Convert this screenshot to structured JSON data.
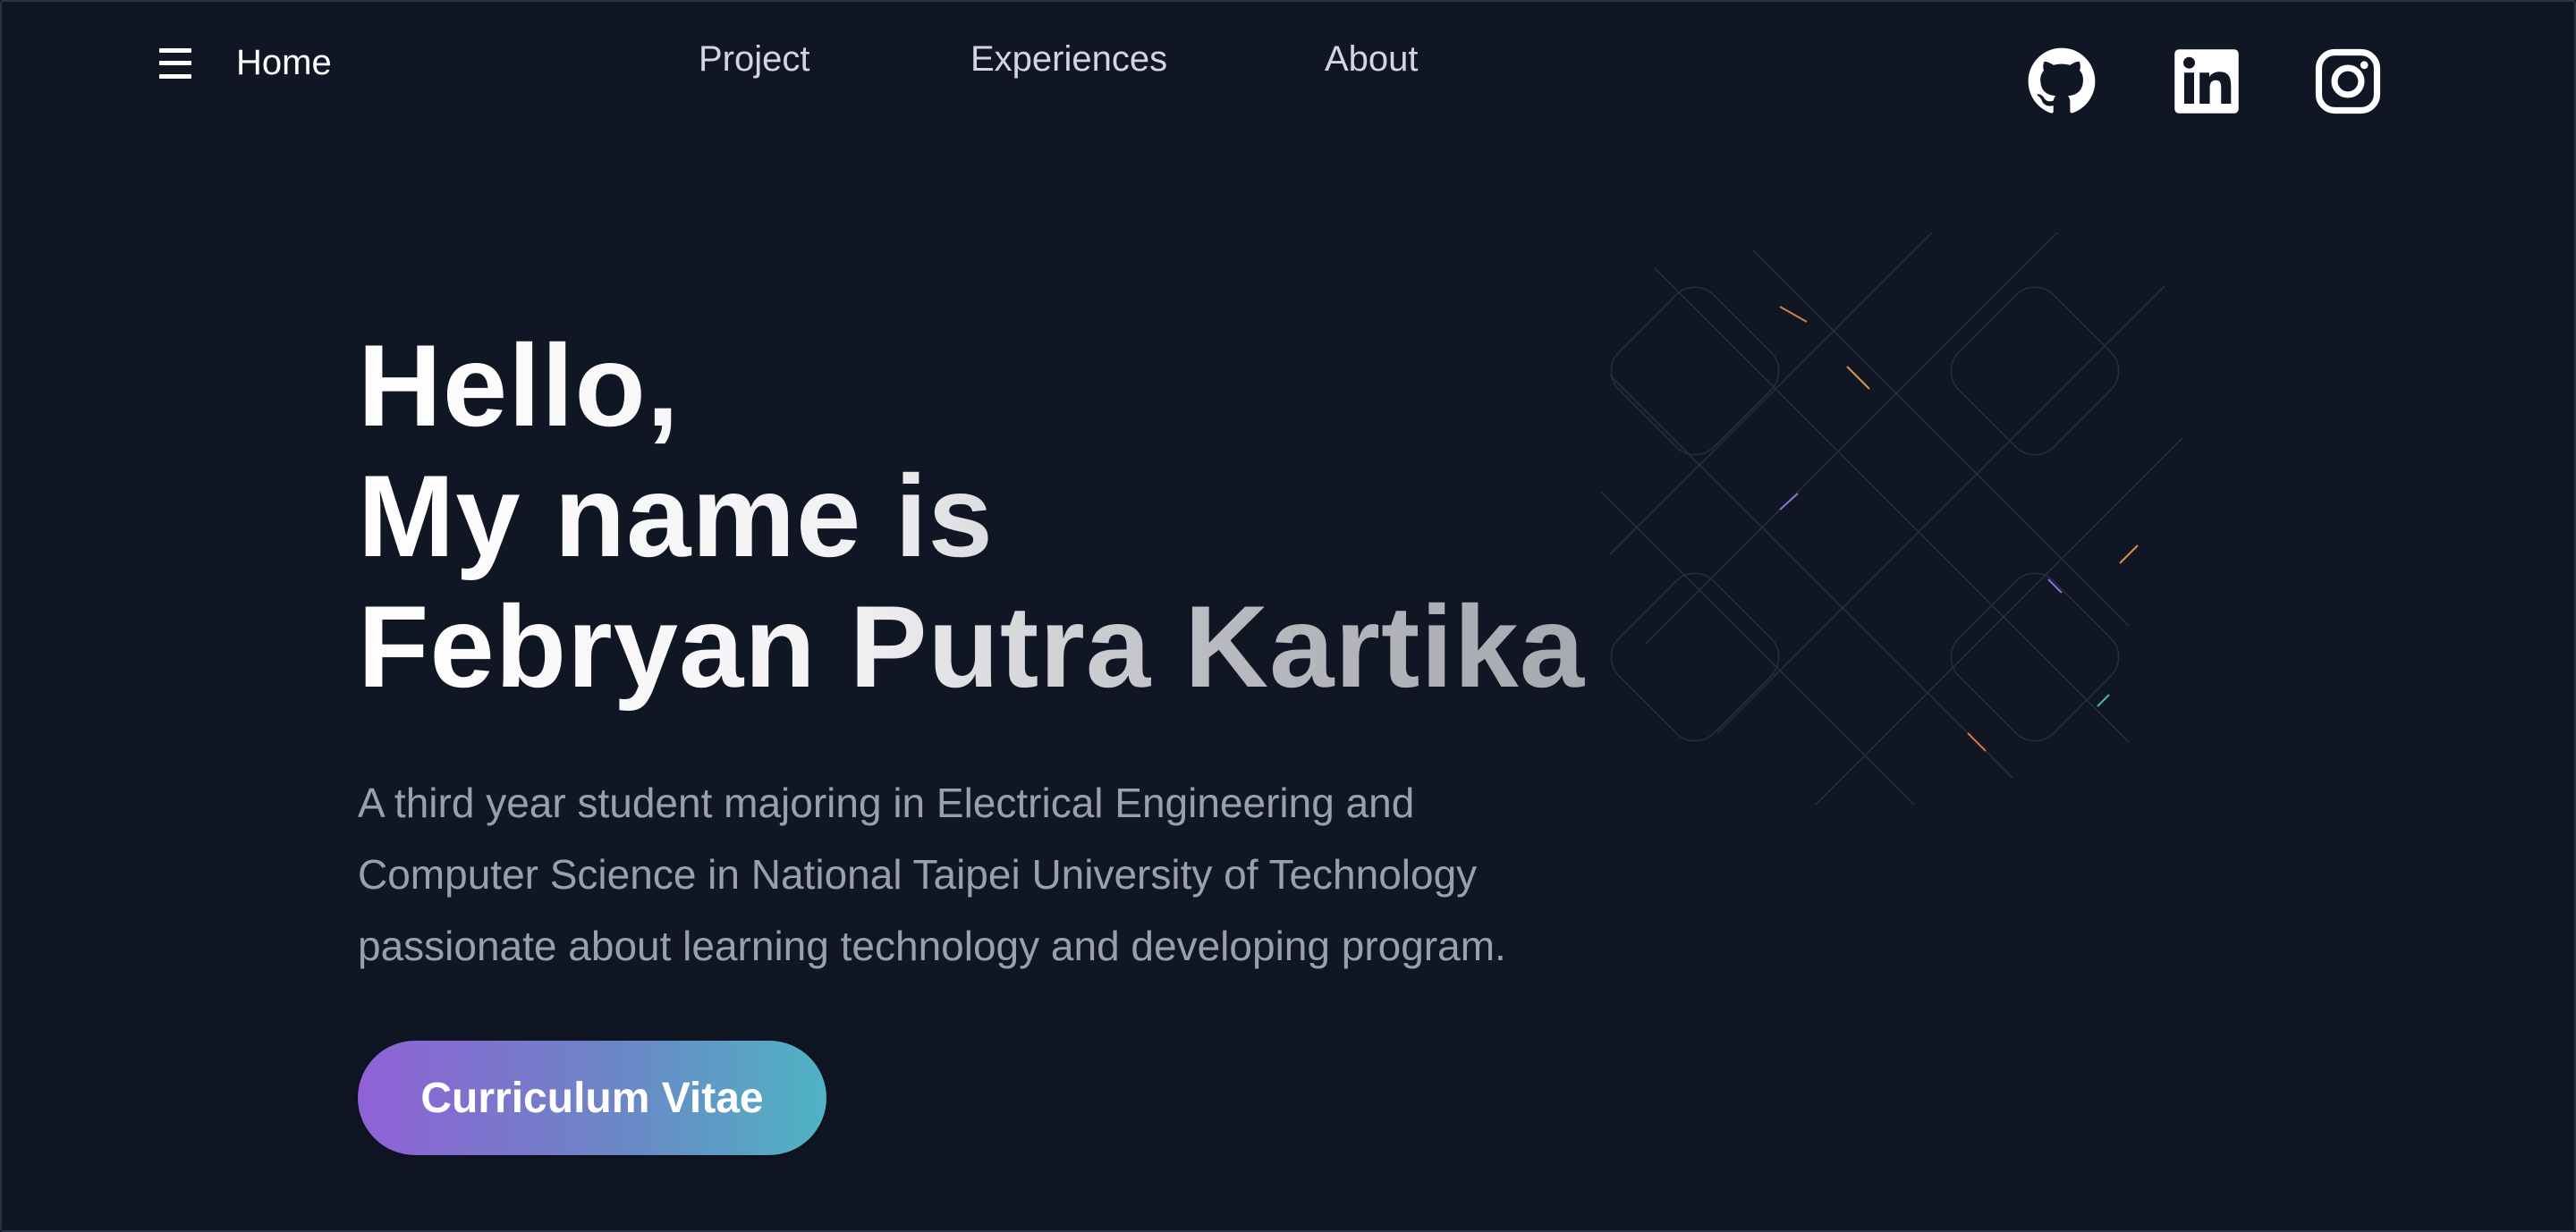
{
  "nav": {
    "home_label": "Home",
    "links": [
      {
        "label": "Project"
      },
      {
        "label": "Experiences"
      },
      {
        "label": "About"
      }
    ],
    "menu_icon": "hamburger-menu-icon"
  },
  "social": [
    {
      "name": "github",
      "icon": "github-icon"
    },
    {
      "name": "linkedin",
      "icon": "linkedin-icon"
    },
    {
      "name": "instagram",
      "icon": "instagram-icon"
    }
  ],
  "hero": {
    "title_lines": [
      "Hello,",
      "My name is",
      "Febryan Putra Kartika"
    ],
    "description_lines": [
      "A third year student majoring in Electrical Engineering and",
      "Computer Science in National Taipei University of Technology",
      "passionate about learning technology and developing program."
    ],
    "cta_label": "Curriculum Vitae"
  },
  "colors": {
    "background": "#111625",
    "nav_text": "#d3d6de",
    "description_text": "#9aa0ab",
    "cta_gradient_start": "#9061d6",
    "cta_gradient_end": "#4fb3c4"
  }
}
